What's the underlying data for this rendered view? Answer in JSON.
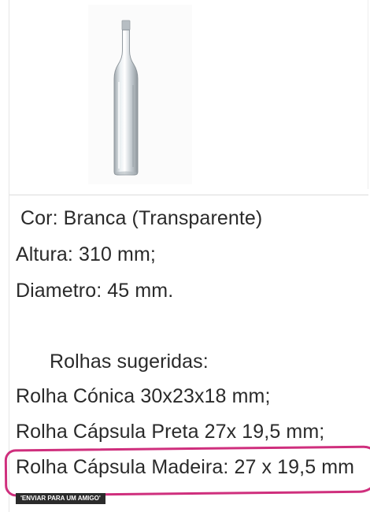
{
  "product": {
    "image": {
      "icon": "glass-bottle-image"
    },
    "details": {
      "color": "Cor: Branca (Transparente)",
      "height": "Altura: 310 mm;",
      "diameter": "Diametro:  45 mm."
    },
    "corks": {
      "heading": "Rolhas sugeridas:",
      "items": [
        "Rolha Cónica 30x23x18 mm;",
        "Rolha Cápsula Preta 27x 19,5 mm;",
        "Rolha Cápsula Madeira: 27 x 19,5 mm"
      ]
    },
    "actions": {
      "send_to_friend": "'ENVIAR PARA UM AMIGO'"
    }
  },
  "annotation": {
    "highlight_color": "#cf2f7d"
  }
}
